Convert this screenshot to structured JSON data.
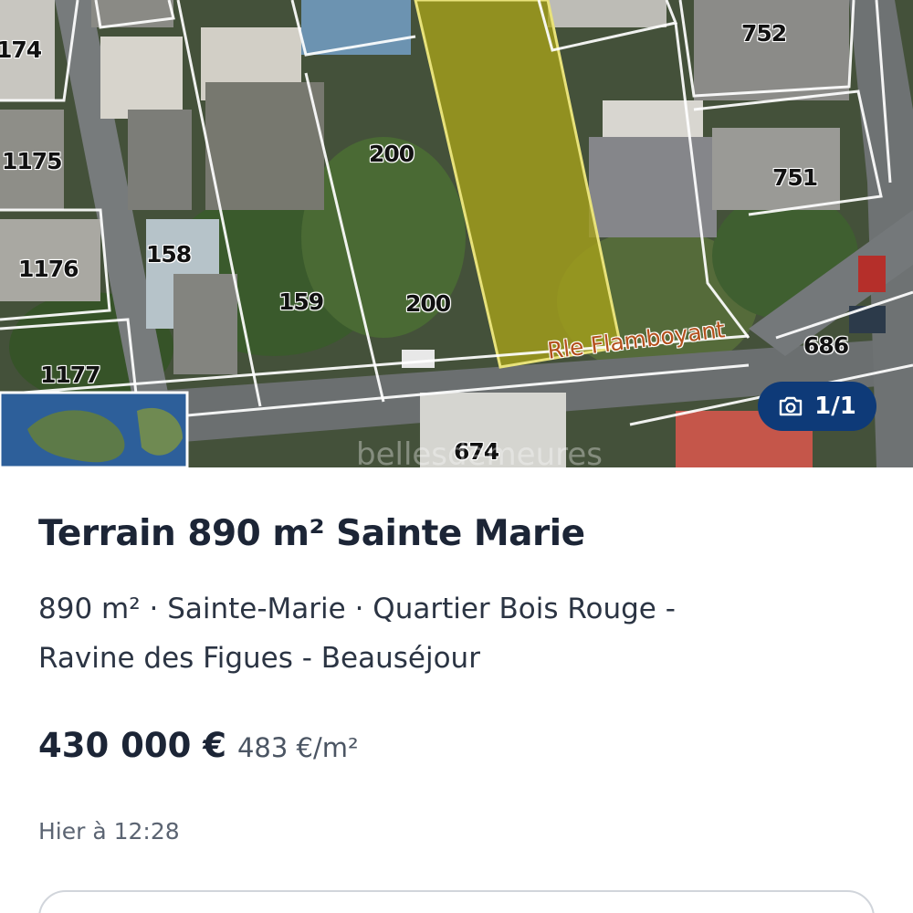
{
  "photo": {
    "parcel_labels": [
      "174",
      "1175",
      "1176",
      "1177",
      "158",
      "159",
      "200",
      "200",
      "752",
      "751",
      "686",
      "674"
    ],
    "street_label": "Rle Flamboyant",
    "watermark": "bellesdemeures",
    "counter": {
      "icon": "camera-icon",
      "text": "1/1",
      "background_color": "#0e3a78"
    },
    "highlight_color": "#a7a21a"
  },
  "listing": {
    "title": "Terrain 890 m² Sainte Marie",
    "subtitle_line1": "890 m² · Sainte-Marie · Quartier Bois Rouge -",
    "subtitle_line2": "Ravine des Figues - Beauséjour",
    "price": "430 000 €",
    "price_per_m2": "483 €/m²",
    "posted": "Hier à 12:28"
  }
}
